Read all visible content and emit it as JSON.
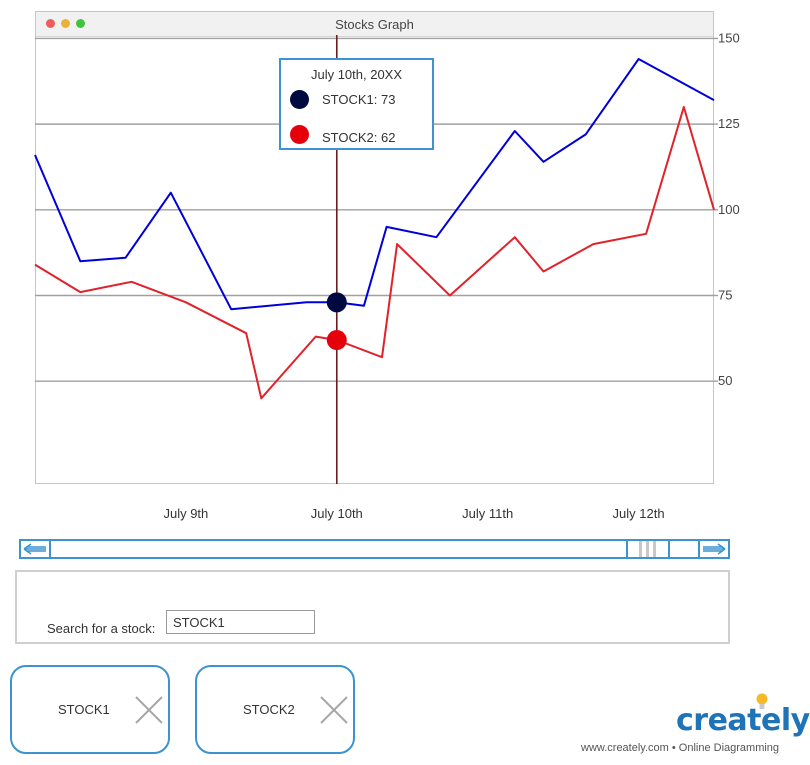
{
  "window": {
    "title": "Stocks Graph"
  },
  "tooltip": {
    "date": "July 10th, 20XX",
    "rows": [
      {
        "label": "STOCK1: 73",
        "color": "#000940"
      },
      {
        "label": "STOCK2: 62",
        "color": "#e5000c"
      }
    ]
  },
  "chart_data": {
    "type": "line",
    "x_labels": [
      "July 9th",
      "July 10th",
      "July 11th",
      "July 12th"
    ],
    "y_ticks": [
      50,
      75,
      100,
      125,
      150
    ],
    "ylim": [
      20,
      151
    ],
    "grid": true,
    "cursor_label": "July 10th",
    "series": [
      {
        "name": "STOCK1",
        "color": "#0000d8",
        "points": [
          [
            8.0,
            116
          ],
          [
            8.3,
            85
          ],
          [
            8.6,
            86
          ],
          [
            8.9,
            105
          ],
          [
            9.3,
            71
          ],
          [
            9.8,
            73
          ],
          [
            10.0,
            73
          ],
          [
            10.18,
            72
          ],
          [
            10.33,
            95
          ],
          [
            10.66,
            92
          ],
          [
            11.18,
            123
          ],
          [
            11.37,
            114
          ],
          [
            11.65,
            122
          ],
          [
            12.0,
            144
          ],
          [
            12.5,
            132
          ]
        ]
      },
      {
        "name": "STOCK2",
        "color": "#e0222a",
        "points": [
          [
            8.0,
            84
          ],
          [
            8.3,
            76
          ],
          [
            8.64,
            79
          ],
          [
            9.0,
            73
          ],
          [
            9.4,
            64
          ],
          [
            9.5,
            45
          ],
          [
            9.86,
            63
          ],
          [
            10.0,
            62
          ],
          [
            10.3,
            57
          ],
          [
            10.4,
            90
          ],
          [
            10.75,
            75
          ],
          [
            11.18,
            92
          ],
          [
            11.37,
            82
          ],
          [
            11.7,
            90
          ],
          [
            12.05,
            93
          ],
          [
            12.3,
            130
          ],
          [
            12.5,
            100
          ]
        ]
      }
    ],
    "markers": [
      {
        "series": "STOCK1",
        "x": 10.0,
        "y": 73,
        "color": "#000940"
      },
      {
        "series": "STOCK2",
        "x": 10.0,
        "y": 62,
        "color": "#e5000c"
      }
    ]
  },
  "search": {
    "label": "Search for a stock:",
    "value": "STOCK1",
    "placeholder": ""
  },
  "chips": [
    {
      "label": "STOCK1"
    },
    {
      "label": "STOCK2"
    }
  ],
  "brand": {
    "name": "creately",
    "tagline": "www.creately.com • Online Diagramming"
  },
  "icons": {
    "scroll_left": "double-arrow-left-icon",
    "scroll_right": "double-arrow-right-icon",
    "remove": "close-x-icon",
    "brand": "lightbulb-icon"
  }
}
